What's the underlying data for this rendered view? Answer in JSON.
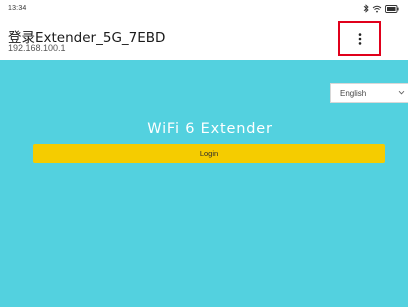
{
  "status_bar": {
    "time": "13:34",
    "icons": [
      "bluetooth-icon",
      "wifi-icon",
      "battery-icon"
    ]
  },
  "header": {
    "title": "登录Extender_5G_7EBD",
    "subtitle": "192.168.100.1",
    "menu_icon": "more-vertical-icon"
  },
  "page": {
    "background_color": "#53d1df",
    "language": {
      "selected": "English",
      "icon": "chevron-down-icon"
    },
    "product_title": "WiFi 6 Extender",
    "login_button": {
      "label": "Login",
      "color": "#f5cc00"
    }
  },
  "highlight_color": "#e0001b"
}
